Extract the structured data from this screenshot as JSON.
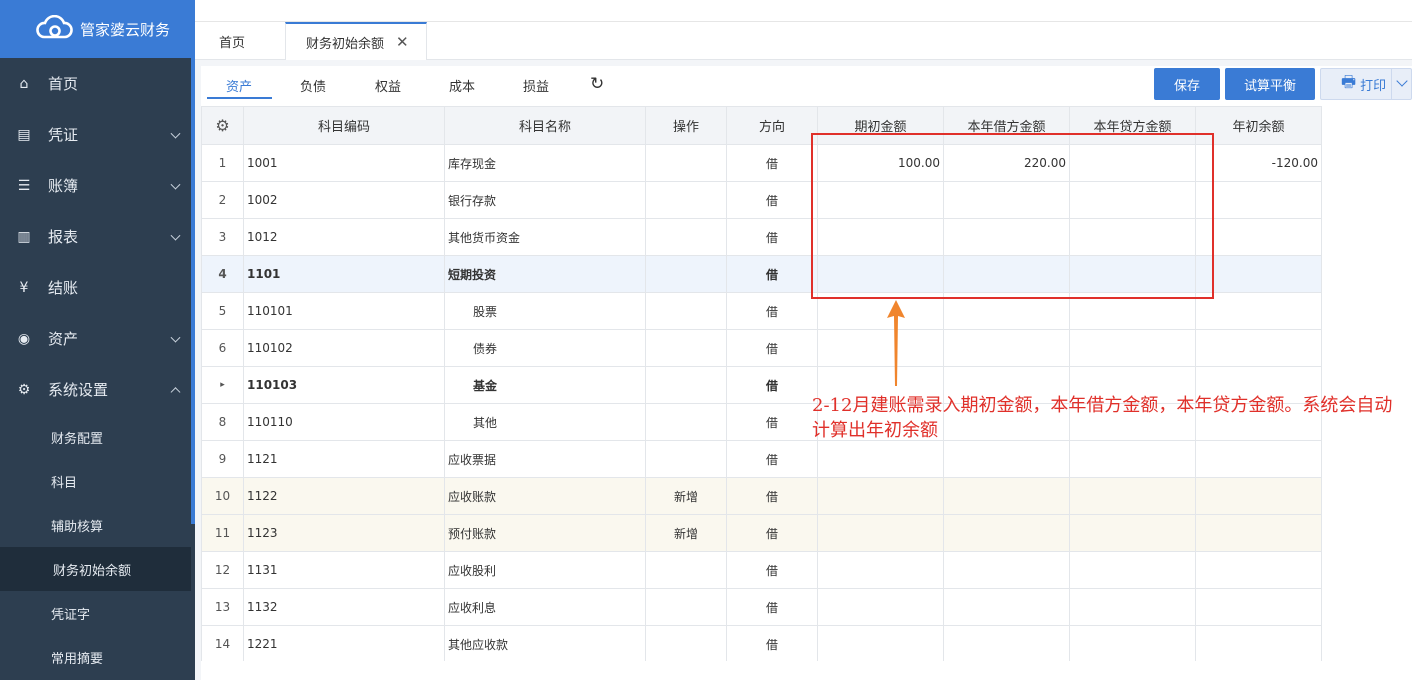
{
  "app": {
    "name": "管家婆云财务"
  },
  "sidebar": {
    "items": [
      {
        "label": "首页",
        "icon": "home-icon",
        "expandable": false
      },
      {
        "label": "凭证",
        "icon": "voucher-icon",
        "expandable": true
      },
      {
        "label": "账簿",
        "icon": "ledger-icon",
        "expandable": true
      },
      {
        "label": "报表",
        "icon": "chart-icon",
        "expandable": true
      },
      {
        "label": "结账",
        "icon": "yen-icon",
        "expandable": false
      },
      {
        "label": "资产",
        "icon": "asset-icon",
        "expandable": true
      },
      {
        "label": "系统设置",
        "icon": "gear-icon",
        "expandable": true,
        "expanded": true
      }
    ],
    "subitems": [
      {
        "label": "财务配置"
      },
      {
        "label": "科目"
      },
      {
        "label": "辅助核算"
      },
      {
        "label": "财务初始余额",
        "active": true
      },
      {
        "label": "凭证字"
      },
      {
        "label": "常用摘要"
      }
    ]
  },
  "tabs": {
    "home": "首页",
    "active": "财务初始余额",
    "close_glyph": "✕"
  },
  "subtabs": [
    "资产",
    "负债",
    "权益",
    "成本",
    "损益"
  ],
  "toolbar": {
    "save": "保存",
    "trial": "试算平衡",
    "print": "打印"
  },
  "table": {
    "headers": [
      "科目编码",
      "科目名称",
      "操作",
      "方向",
      "期初金额",
      "本年借方金额",
      "本年贷方金额",
      "年初余额"
    ],
    "rows": [
      {
        "idx": "1",
        "code": "1001",
        "name": "库存现金",
        "op": "",
        "dir": "借",
        "opening": "100.00",
        "debit": "220.00",
        "credit": "",
        "year_start": "-120.00"
      },
      {
        "idx": "2",
        "code": "1002",
        "name": "银行存款",
        "op": "",
        "dir": "借",
        "opening": "",
        "debit": "",
        "credit": "",
        "year_start": ""
      },
      {
        "idx": "3",
        "code": "1012",
        "name": "其他货币资金",
        "op": "",
        "dir": "借",
        "opening": "",
        "debit": "",
        "credit": "",
        "year_start": ""
      },
      {
        "idx": "4",
        "code": "1101",
        "name": "短期投资",
        "op": "",
        "dir": "借",
        "opening": "",
        "debit": "",
        "credit": "",
        "year_start": "",
        "bold": true,
        "highlight": true
      },
      {
        "idx": "5",
        "code": "110101",
        "name": "股票",
        "op": "",
        "dir": "借",
        "opening": "",
        "debit": "",
        "credit": "",
        "year_start": "",
        "level": 2
      },
      {
        "idx": "6",
        "code": "110102",
        "name": "债券",
        "op": "",
        "dir": "借",
        "opening": "",
        "debit": "",
        "credit": "",
        "year_start": "",
        "level": 2
      },
      {
        "idx": "▸",
        "code": "110103",
        "name": "基金",
        "op": "",
        "dir": "借",
        "opening": "",
        "debit": "",
        "credit": "",
        "year_start": "",
        "level": 2,
        "bold": true,
        "current": true
      },
      {
        "idx": "8",
        "code": "110110",
        "name": "其他",
        "op": "",
        "dir": "借",
        "opening": "",
        "debit": "",
        "credit": "",
        "year_start": "",
        "level": 2
      },
      {
        "idx": "9",
        "code": "1121",
        "name": "应收票据",
        "op": "",
        "dir": "借",
        "opening": "",
        "debit": "",
        "credit": "",
        "year_start": ""
      },
      {
        "idx": "10",
        "code": "1122",
        "name": "应收账款",
        "op": "新增",
        "dir": "借",
        "opening": "",
        "debit": "",
        "credit": "",
        "year_start": "",
        "yellow": true
      },
      {
        "idx": "11",
        "code": "1123",
        "name": "预付账款",
        "op": "新增",
        "dir": "借",
        "opening": "",
        "debit": "",
        "credit": "",
        "year_start": "",
        "yellow": true
      },
      {
        "idx": "12",
        "code": "1131",
        "name": "应收股利",
        "op": "",
        "dir": "借",
        "opening": "",
        "debit": "",
        "credit": "",
        "year_start": ""
      },
      {
        "idx": "13",
        "code": "1132",
        "name": "应收利息",
        "op": "",
        "dir": "借",
        "opening": "",
        "debit": "",
        "credit": "",
        "year_start": ""
      },
      {
        "idx": "14",
        "code": "1221",
        "name": "其他应收款",
        "op": "",
        "dir": "借",
        "opening": "",
        "debit": "",
        "credit": "",
        "year_start": ""
      }
    ]
  },
  "annotation": {
    "text": "2-12月建账需录入期初金额，本年借方金额，本年贷方金额。系统会自动计算出年初余额",
    "color": "#e0302a"
  },
  "colors": {
    "brand": "#3a7bd5",
    "sidebar": "#2d3e50",
    "annotation_box": "#e0302a",
    "arrow": "#f0852d"
  }
}
